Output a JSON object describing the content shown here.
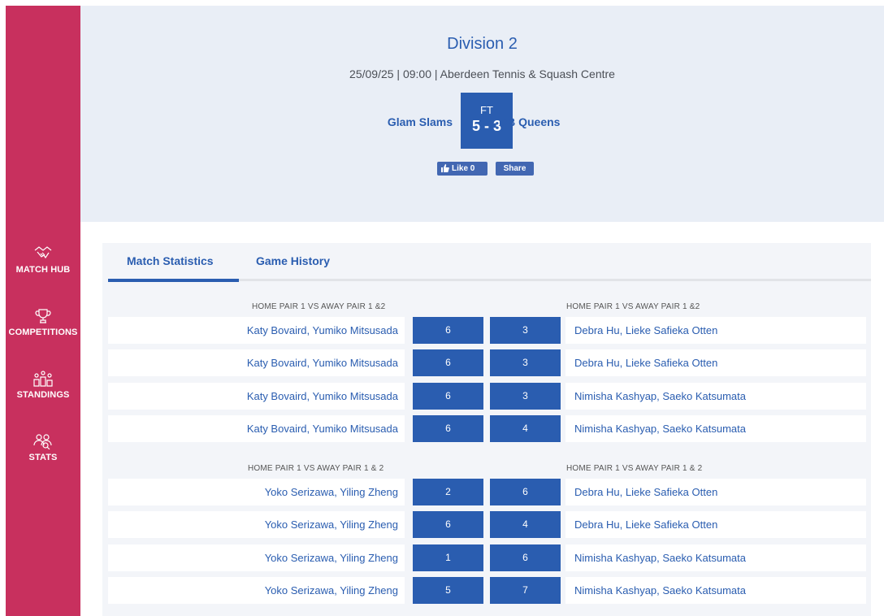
{
  "sidebar": {
    "items": [
      {
        "label": "MATCH HUB",
        "icon": "handshake-icon"
      },
      {
        "label": "COMPETITIONS",
        "icon": "trophy-icon"
      },
      {
        "label": "STANDINGS",
        "icon": "podium-icon"
      },
      {
        "label": "STATS",
        "icon": "people-icon"
      }
    ]
  },
  "header": {
    "title": "Division 2",
    "meta": "25/09/25 | 09:00 | Aberdeen Tennis & Squash Centre",
    "home_team": "Glam Slams",
    "away_team": "DB Queens",
    "status": "FT",
    "score": "5 - 3",
    "like_label": "Like 0",
    "share_label": "Share"
  },
  "tabs": [
    {
      "label": "Match Statistics",
      "active": true
    },
    {
      "label": "Game History",
      "active": false
    }
  ],
  "sections": [
    {
      "home_heading": "HOME PAIR 1 VS AWAY PAIR 1 &2",
      "away_heading": "HOME PAIR 1 VS AWAY PAIR 1 &2",
      "rows": [
        {
          "home": "Katy Bovaird, Yumiko Mitsusada",
          "home_score": "6",
          "away_score": "3",
          "away": "Debra Hu, Lieke Safieka Otten"
        },
        {
          "home": "Katy Bovaird, Yumiko Mitsusada",
          "home_score": "6",
          "away_score": "3",
          "away": "Debra Hu, Lieke Safieka Otten"
        },
        {
          "home": "Katy Bovaird, Yumiko Mitsusada",
          "home_score": "6",
          "away_score": "3",
          "away": "Nimisha Kashyap, Saeko Katsumata"
        },
        {
          "home": "Katy Bovaird, Yumiko Mitsusada",
          "home_score": "6",
          "away_score": "4",
          "away": "Nimisha Kashyap, Saeko Katsumata"
        }
      ]
    },
    {
      "home_heading": "HOME PAIR 1 VS AWAY PAIR 1 & 2",
      "away_heading": "HOME PAIR 1 VS AWAY PAIR 1 & 2",
      "rows": [
        {
          "home": "Yoko Serizawa, Yiling Zheng",
          "home_score": "2",
          "away_score": "6",
          "away": "Debra Hu, Lieke Safieka Otten"
        },
        {
          "home": "Yoko Serizawa, Yiling Zheng",
          "home_score": "6",
          "away_score": "4",
          "away": "Debra Hu, Lieke Safieka Otten"
        },
        {
          "home": "Yoko Serizawa, Yiling Zheng",
          "home_score": "1",
          "away_score": "6",
          "away": "Nimisha Kashyap, Saeko Katsumata"
        },
        {
          "home": "Yoko Serizawa, Yiling Zheng",
          "home_score": "5",
          "away_score": "7",
          "away": "Nimisha Kashyap, Saeko Katsumata"
        }
      ]
    }
  ],
  "colors": {
    "sidebar": "#c8305e",
    "accent": "#2a5db0",
    "header_bg": "#e9eef6",
    "facebook": "#4267b2"
  }
}
